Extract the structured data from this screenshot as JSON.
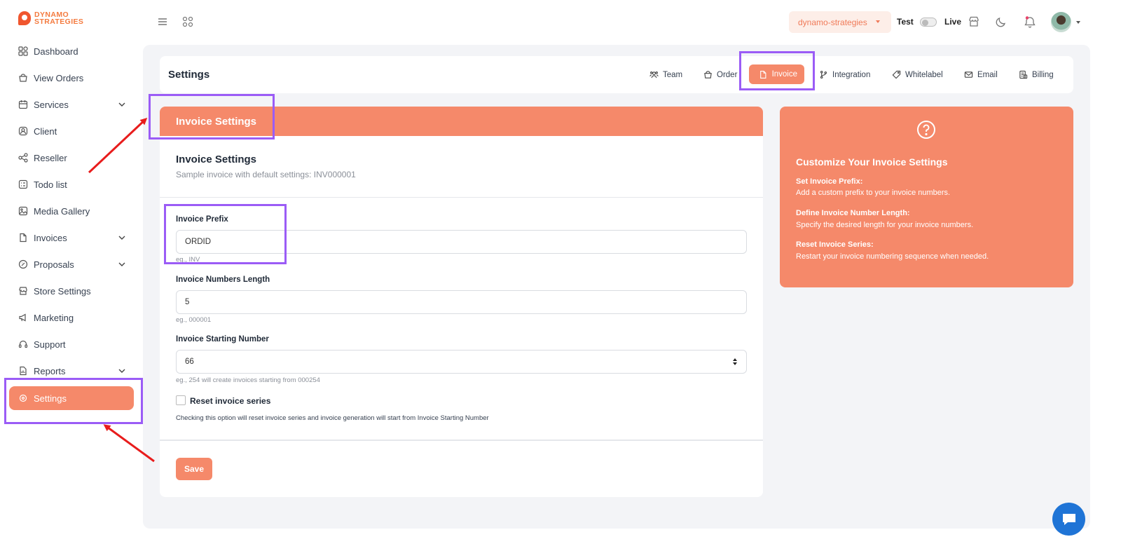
{
  "brand": {
    "line1": "DYNAMO",
    "line2": "STRATEGIES",
    "color": "#f47a3e"
  },
  "sidebar": {
    "items": [
      {
        "label": "Dashboard",
        "icon": "dashboard-icon"
      },
      {
        "label": "View Orders",
        "icon": "basket-icon"
      },
      {
        "label": "Services",
        "icon": "calendar-icon",
        "expandable": true
      },
      {
        "label": "Client",
        "icon": "user-icon"
      },
      {
        "label": "Reseller",
        "icon": "share-icon"
      },
      {
        "label": "Todo list",
        "icon": "todo-icon"
      },
      {
        "label": "Media Gallery",
        "icon": "image-icon"
      },
      {
        "label": "Invoices",
        "icon": "document-icon",
        "expandable": true
      },
      {
        "label": "Proposals",
        "icon": "tag-icon",
        "expandable": true
      },
      {
        "label": "Store Settings",
        "icon": "store-icon"
      },
      {
        "label": "Marketing",
        "icon": "megaphone-icon"
      },
      {
        "label": "Support",
        "icon": "headset-icon"
      },
      {
        "label": "Reports",
        "icon": "report-icon",
        "expandable": true
      },
      {
        "label": "Settings",
        "icon": "gear-icon",
        "active": true
      }
    ]
  },
  "topbar": {
    "store": "dynamo-strategies",
    "mode_test": "Test",
    "mode_live": "Live"
  },
  "page": {
    "title": "Settings"
  },
  "tabs": [
    {
      "label": "Team",
      "icon": "team-icon"
    },
    {
      "label": "Order",
      "icon": "basket-icon"
    },
    {
      "label": "Invoice",
      "icon": "document-icon",
      "active": true
    },
    {
      "label": "Integration",
      "icon": "branch-icon"
    },
    {
      "label": "Whitelabel",
      "icon": "tag-icon"
    },
    {
      "label": "Email",
      "icon": "mail-icon"
    },
    {
      "label": "Billing",
      "icon": "billing-icon"
    }
  ],
  "invoice_card": {
    "header": "Invoice Settings",
    "section_title": "Invoice Settings",
    "section_subtitle": "Sample invoice with default settings: INV000001",
    "prefix": {
      "label": "Invoice Prefix",
      "value": "ORDID",
      "hint": "eg., INV"
    },
    "length": {
      "label": "Invoice Numbers Length",
      "value": "5",
      "hint": "eg., 000001"
    },
    "starting": {
      "label": "Invoice Starting Number",
      "value": "66",
      "hint": "eg., 254 will create invoices starting from 000254"
    },
    "reset": {
      "label": "Reset invoice series",
      "checked": false,
      "help": "Checking this option will reset invoice series and invoice generation will start from Invoice Starting Number"
    },
    "save_label": "Save"
  },
  "help_card": {
    "title": "Customize Your Invoice Settings",
    "items": [
      {
        "heading": "Set Invoice Prefix:",
        "text": "Add a custom prefix to your invoice numbers."
      },
      {
        "heading": "Define Invoice Number Length:",
        "text": "Specify the desired length for your invoice numbers."
      },
      {
        "heading": "Reset Invoice Series:",
        "text": "Restart your invoice numbering sequence when needed."
      }
    ]
  },
  "colors": {
    "accent": "#f5896a",
    "annotation": "#9b5cf6",
    "arrow": "#e81c1c",
    "chat": "#1f74d6"
  }
}
